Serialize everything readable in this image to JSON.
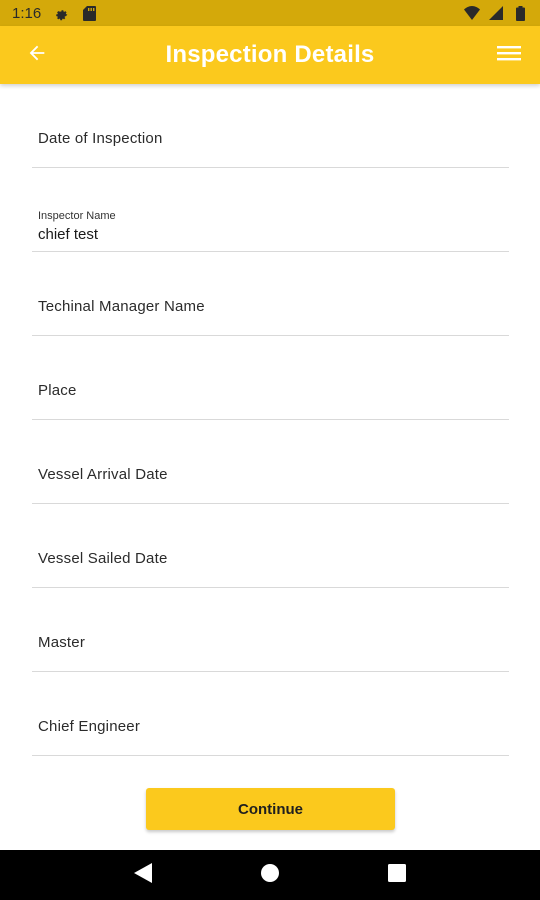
{
  "status_bar": {
    "time": "1:16",
    "icons": [
      "gear-icon",
      "sd-card-icon",
      "wifi-icon",
      "signal-icon",
      "battery-icon"
    ]
  },
  "app_bar": {
    "title": "Inspection Details",
    "back_icon": "arrow-left-icon",
    "menu_icon": "hamburger-menu-icon",
    "color": "#fbc91d",
    "status_color": "#d4a90a"
  },
  "form": {
    "fields": [
      {
        "label": "Date of Inspection",
        "value": ""
      },
      {
        "label": "Inspector Name",
        "value": "chief test"
      },
      {
        "label": "Techinal Manager Name",
        "value": ""
      },
      {
        "label": "Place",
        "value": ""
      },
      {
        "label": "Vessel Arrival Date",
        "value": ""
      },
      {
        "label": "Vessel Sailed Date",
        "value": ""
      },
      {
        "label": "Master",
        "value": ""
      },
      {
        "label": "Chief Engineer",
        "value": ""
      }
    ]
  },
  "continue_button": {
    "label": "Continue",
    "color": "#fbc91d"
  },
  "nav_bar": {
    "icons": [
      "back-triangle-icon",
      "home-circle-icon",
      "recents-square-icon"
    ]
  }
}
